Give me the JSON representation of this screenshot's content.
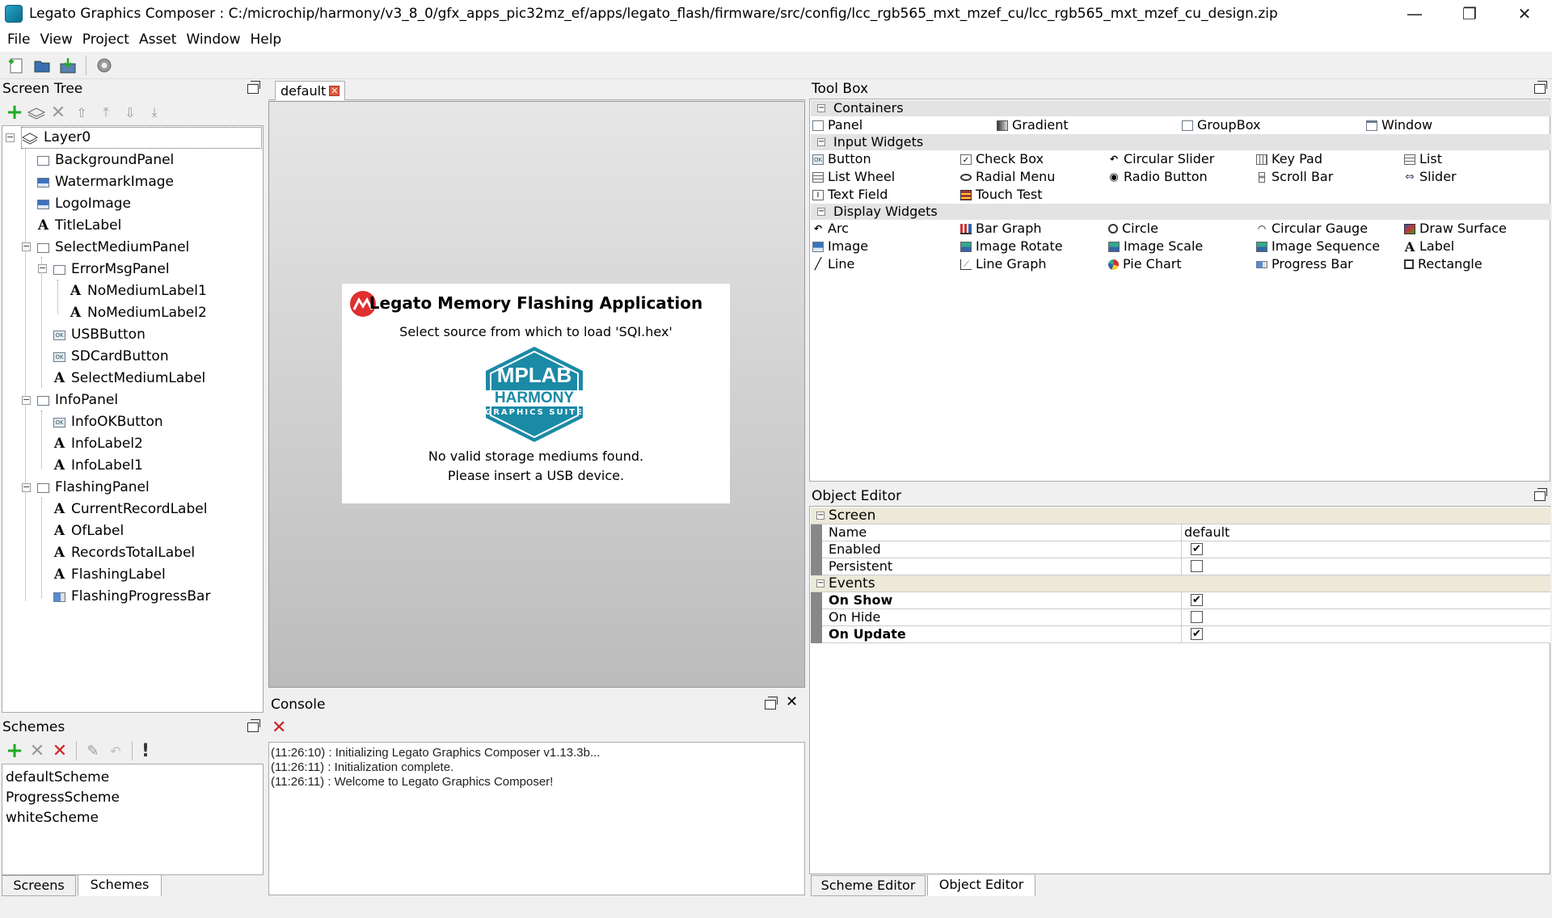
{
  "window": {
    "title": "Legato Graphics Composer : C:/microchip/harmony/v3_8_0/gfx_apps_pic32mz_ef/apps/legato_flash/firmware/src/config/lcc_rgb565_mxt_mzef_cu/lcc_rgb565_mxt_mzef_cu_design.zip",
    "controls": {
      "minimize": "—",
      "restore": "❐",
      "close": "✕"
    }
  },
  "menu": [
    "File",
    "View",
    "Project",
    "Asset",
    "Window",
    "Help"
  ],
  "screen_tree": {
    "title": "Screen Tree",
    "nodes": [
      {
        "label": "Layer0",
        "icon": "layer-icon"
      },
      {
        "label": "BackgroundPanel",
        "icon": "panel-icon"
      },
      {
        "label": "WatermarkImage",
        "icon": "image-icon"
      },
      {
        "label": "LogoImage",
        "icon": "image-icon"
      },
      {
        "label": "TitleLabel",
        "icon": "label-icon"
      },
      {
        "label": "SelectMediumPanel",
        "icon": "panel-icon"
      },
      {
        "label": "ErrorMsgPanel",
        "icon": "panel-icon"
      },
      {
        "label": "NoMediumLabel1",
        "icon": "label-icon"
      },
      {
        "label": "NoMediumLabel2",
        "icon": "label-icon"
      },
      {
        "label": "USBButton",
        "icon": "button-icon"
      },
      {
        "label": "SDCardButton",
        "icon": "button-icon"
      },
      {
        "label": "SelectMediumLabel",
        "icon": "label-icon"
      },
      {
        "label": "InfoPanel",
        "icon": "panel-icon"
      },
      {
        "label": "InfoOKButton",
        "icon": "button-icon"
      },
      {
        "label": "InfoLabel2",
        "icon": "label-icon"
      },
      {
        "label": "InfoLabel1",
        "icon": "label-icon"
      },
      {
        "label": "FlashingPanel",
        "icon": "panel-icon"
      },
      {
        "label": "CurrentRecordLabel",
        "icon": "label-icon"
      },
      {
        "label": "OfLabel",
        "icon": "label-icon"
      },
      {
        "label": "RecordsTotalLabel",
        "icon": "label-icon"
      },
      {
        "label": "FlashingLabel",
        "icon": "label-icon"
      },
      {
        "label": "FlashingProgressBar",
        "icon": "progress-bar-icon"
      }
    ]
  },
  "schemes": {
    "title": "Schemes",
    "items": [
      "defaultScheme",
      "ProgressScheme",
      "whiteScheme"
    ],
    "tabs": [
      "Screens",
      "Schemes"
    ]
  },
  "editor": {
    "tab": "default",
    "preview": {
      "title": "Legato Memory Flashing Application",
      "subtitle": "Select source from which to load 'SQI.hex'",
      "logo_line1": "MPLAB",
      "logo_line2": "HARMONY",
      "logo_line3": "GRAPHICS SUITE",
      "message1": "No valid storage mediums found.",
      "message2": "Please insert a USB device."
    }
  },
  "console": {
    "title": "Console",
    "lines": [
      "(11:26:10) : Initializing Legato Graphics Composer v1.13.3b...",
      "(11:26:11) : Initialization complete.",
      "(11:26:11) : Welcome to Legato Graphics Composer!"
    ]
  },
  "toolbox": {
    "title": "Tool Box",
    "sections": {
      "containers": "Containers",
      "input": "Input Widgets",
      "display": "Display Widgets"
    },
    "containers": [
      "Panel",
      "Gradient",
      "GroupBox",
      "Window"
    ],
    "input": [
      "Button",
      "Check Box",
      "Circular Slider",
      "Key Pad",
      "List",
      "List Wheel",
      "Radial Menu",
      "Radio Button",
      "Scroll Bar",
      "Slider",
      "Text Field",
      "Touch Test"
    ],
    "display": [
      "Arc",
      "Bar Graph",
      "Circle",
      "Circular Gauge",
      "Draw Surface",
      "Image",
      "Image Rotate",
      "Image Scale",
      "Image Sequence",
      "Label",
      "Line",
      "Line Graph",
      "Pie Chart",
      "Progress Bar",
      "Rectangle"
    ]
  },
  "object_editor": {
    "title": "Object Editor",
    "sections": {
      "screen": "Screen",
      "events": "Events"
    },
    "screen_props": [
      {
        "name": "Name",
        "value": "default"
      },
      {
        "name": "Enabled",
        "checked": true
      },
      {
        "name": "Persistent",
        "checked": false
      }
    ],
    "event_props": [
      {
        "name": "On Show",
        "checked": true
      },
      {
        "name": "On Hide",
        "checked": false
      },
      {
        "name": "On Update",
        "checked": true
      }
    ],
    "tabs": [
      "Scheme Editor",
      "Object Editor"
    ]
  },
  "colors": {
    "accent_green": "#22aa22",
    "delete_red": "#cc2222",
    "harmony_teal": "#1b8aa6"
  }
}
